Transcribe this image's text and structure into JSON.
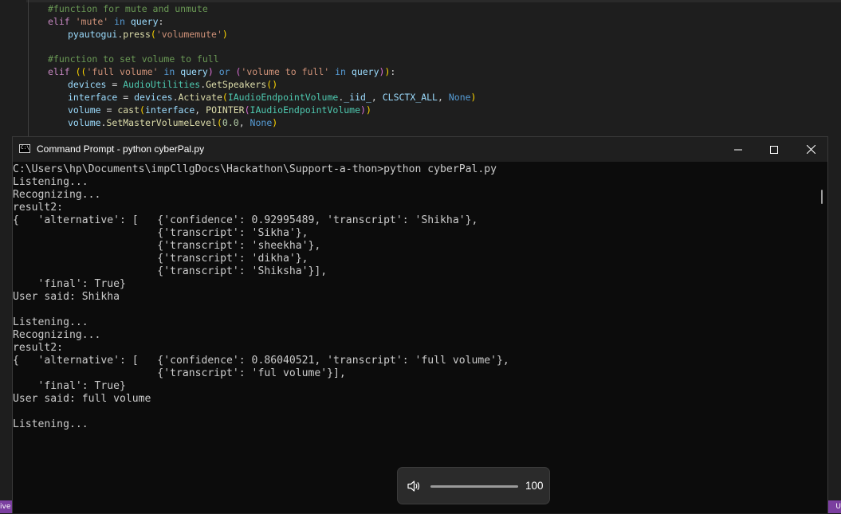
{
  "editor": {
    "lines": [
      {
        "indent": 0,
        "parts": [
          {
            "c": "cm",
            "t": "#function for mute and unmute"
          }
        ]
      },
      {
        "indent": 0,
        "parts": [
          {
            "c": "kw",
            "t": "elif "
          },
          {
            "c": "st",
            "t": "'mute'"
          },
          {
            "c": "bl",
            "t": " in "
          },
          {
            "c": "vr",
            "t": "query"
          },
          {
            "c": "",
            "t": ":"
          }
        ]
      },
      {
        "indent": 1,
        "parts": [
          {
            "c": "vr",
            "t": "pyautogui"
          },
          {
            "c": "",
            "t": "."
          },
          {
            "c": "fn",
            "t": "press"
          },
          {
            "c": "br",
            "t": "("
          },
          {
            "c": "st",
            "t": "'volumemute'"
          },
          {
            "c": "br",
            "t": ")"
          }
        ]
      },
      {
        "indent": 0,
        "parts": []
      },
      {
        "indent": 0,
        "parts": [
          {
            "c": "cm",
            "t": "#function to set volume to full"
          }
        ]
      },
      {
        "indent": 0,
        "parts": [
          {
            "c": "kw",
            "t": "elif "
          },
          {
            "c": "br",
            "t": "(("
          },
          {
            "c": "st",
            "t": "'full volume'"
          },
          {
            "c": "bl",
            "t": " in "
          },
          {
            "c": "vr",
            "t": "query"
          },
          {
            "c": "br2",
            "t": ")"
          },
          {
            "c": "bl",
            "t": " or "
          },
          {
            "c": "br2",
            "t": "("
          },
          {
            "c": "st",
            "t": "'volume to full'"
          },
          {
            "c": "bl",
            "t": " in "
          },
          {
            "c": "vr",
            "t": "query"
          },
          {
            "c": "br2",
            "t": ")"
          },
          {
            "c": "br",
            "t": ")"
          },
          {
            "c": "",
            "t": ":"
          }
        ]
      },
      {
        "indent": 1,
        "parts": [
          {
            "c": "vr",
            "t": "devices"
          },
          {
            "c": "",
            "t": " = "
          },
          {
            "c": "cl",
            "t": "AudioUtilities"
          },
          {
            "c": "",
            "t": "."
          },
          {
            "c": "fn",
            "t": "GetSpeakers"
          },
          {
            "c": "br",
            "t": "()"
          }
        ]
      },
      {
        "indent": 1,
        "parts": [
          {
            "c": "vr",
            "t": "interface"
          },
          {
            "c": "",
            "t": " = "
          },
          {
            "c": "vr",
            "t": "devices"
          },
          {
            "c": "",
            "t": "."
          },
          {
            "c": "fn",
            "t": "Activate"
          },
          {
            "c": "br",
            "t": "("
          },
          {
            "c": "cl",
            "t": "IAudioEndpointVolume"
          },
          {
            "c": "",
            "t": "."
          },
          {
            "c": "vr",
            "t": "_iid_"
          },
          {
            "c": "",
            "t": ", "
          },
          {
            "c": "vr",
            "t": "CLSCTX_ALL"
          },
          {
            "c": "",
            "t": ", "
          },
          {
            "c": "bl",
            "t": "None"
          },
          {
            "c": "br",
            "t": ")"
          }
        ]
      },
      {
        "indent": 1,
        "parts": [
          {
            "c": "vr",
            "t": "volume"
          },
          {
            "c": "",
            "t": " = "
          },
          {
            "c": "fn",
            "t": "cast"
          },
          {
            "c": "br",
            "t": "("
          },
          {
            "c": "vr",
            "t": "interface"
          },
          {
            "c": "",
            "t": ", "
          },
          {
            "c": "fn",
            "t": "POINTER"
          },
          {
            "c": "br2",
            "t": "("
          },
          {
            "c": "cl",
            "t": "IAudioEndpointVolume"
          },
          {
            "c": "br2",
            "t": ")"
          },
          {
            "c": "br",
            "t": ")"
          }
        ]
      },
      {
        "indent": 1,
        "parts": [
          {
            "c": "vr",
            "t": "volume"
          },
          {
            "c": "",
            "t": "."
          },
          {
            "c": "fn",
            "t": "SetMasterVolumeLevel"
          },
          {
            "c": "br",
            "t": "("
          },
          {
            "c": "nm",
            "t": "0.0"
          },
          {
            "c": "",
            "t": ", "
          },
          {
            "c": "bl",
            "t": "None"
          },
          {
            "c": "br",
            "t": ")"
          }
        ]
      }
    ]
  },
  "status": {
    "left": "ive S",
    "right": "U"
  },
  "cmd": {
    "title": "Command Prompt - python  cyberPal.py",
    "icon_label": "C:\\",
    "lines": [
      "C:\\Users\\hp\\Documents\\impCllgDocs\\Hackathon\\Support-a-thon>python cyberPal.py",
      "Listening...",
      "Recognizing...",
      "result2:",
      "{   'alternative': [   {'confidence': 0.92995489, 'transcript': 'Shikha'},",
      "                       {'transcript': 'Sikha'},",
      "                       {'transcript': 'sheekha'},",
      "                       {'transcript': 'dikha'},",
      "                       {'transcript': 'Shiksha'}],",
      "    'final': True}",
      "User said: Shikha",
      "",
      "Listening...",
      "Recognizing...",
      "result2:",
      "{   'alternative': [   {'confidence': 0.86040521, 'transcript': 'full volume'},",
      "                       {'transcript': 'ful volume'}],",
      "    'final': True}",
      "User said: full volume",
      "",
      "Listening..."
    ]
  },
  "volume": {
    "level": 100,
    "label": "100",
    "fraction": 1.0
  }
}
